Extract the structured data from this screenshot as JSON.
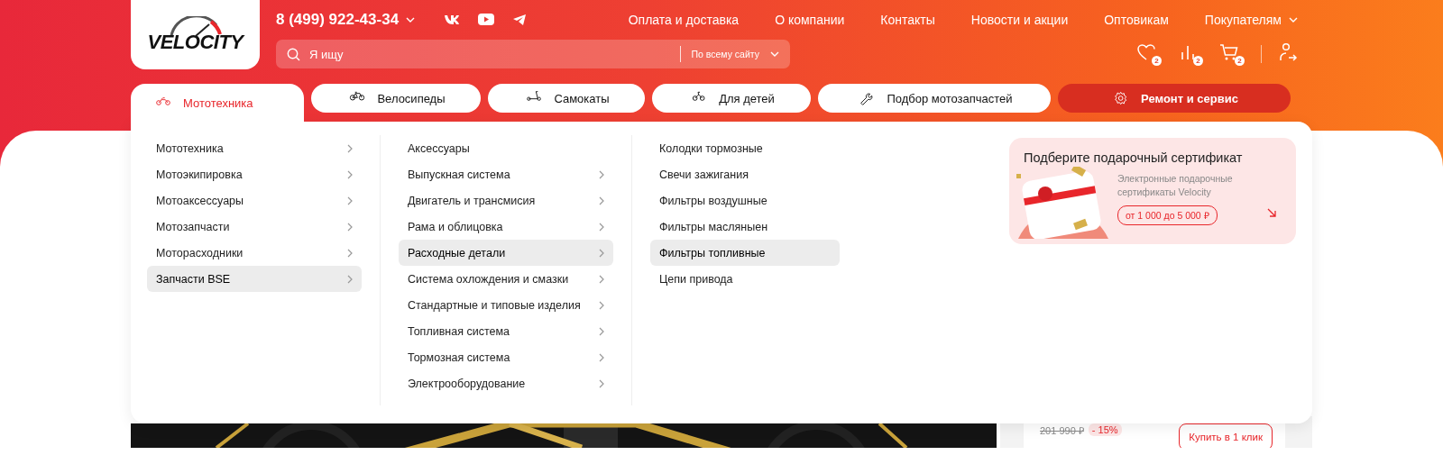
{
  "header": {
    "logo": "VELOCITY",
    "phone": "8 (499) 922-43-34",
    "nav_links": [
      {
        "label": "Оплата и доставка",
        "dropdown": false
      },
      {
        "label": "О компании",
        "dropdown": false
      },
      {
        "label": "Контакты",
        "dropdown": false
      },
      {
        "label": "Новости и акции",
        "dropdown": false
      },
      {
        "label": "Оптовикам",
        "dropdown": false
      },
      {
        "label": "Покупателям",
        "dropdown": true
      }
    ],
    "search": {
      "placeholder": "Я ищу",
      "scope": "По всему сайту"
    },
    "user_actions": [
      {
        "kind": "favorites",
        "badge": "2"
      },
      {
        "kind": "compare",
        "badge": "2"
      },
      {
        "kind": "cart",
        "badge": "2"
      },
      {
        "kind": "account"
      }
    ]
  },
  "categories": [
    {
      "label": "Мототехника",
      "kind": "moto",
      "selected": true,
      "accent": false
    },
    {
      "label": "Велосипеды",
      "kind": "bicycle",
      "selected": false,
      "accent": false
    },
    {
      "label": "Самокаты",
      "kind": "scooter",
      "selected": false,
      "accent": false
    },
    {
      "label": "Для детей",
      "kind": "kids",
      "selected": false,
      "accent": false
    },
    {
      "label": "Подбор мотозапчастей",
      "kind": "wrench",
      "selected": false,
      "accent": false
    },
    {
      "label": "Ремонт и сервис",
      "kind": "gear",
      "selected": false,
      "accent": true
    }
  ],
  "menu_columns": [
    {
      "items": [
        {
          "label": "Мототехника",
          "has_children": true,
          "selected": false
        },
        {
          "label": "Мотоэкипировка",
          "has_children": true,
          "selected": false
        },
        {
          "label": "Мотоаксессуары",
          "has_children": true,
          "selected": false
        },
        {
          "label": "Мотозапчасти",
          "has_children": true,
          "selected": false
        },
        {
          "label": "Моторасходники",
          "has_children": true,
          "selected": false
        },
        {
          "label": "Запчасти BSE",
          "has_children": true,
          "selected": true
        }
      ]
    },
    {
      "items": [
        {
          "label": "Аксессуары",
          "has_children": false,
          "selected": false
        },
        {
          "label": "Выпускная система",
          "has_children": true,
          "selected": false
        },
        {
          "label": "Двигатель и трансмисия",
          "has_children": true,
          "selected": false
        },
        {
          "label": "Рама и облицовка",
          "has_children": true,
          "selected": false
        },
        {
          "label": "Расходные детали",
          "has_children": true,
          "selected": true
        },
        {
          "label": "Система охлождения и смазки",
          "has_children": true,
          "selected": false
        },
        {
          "label": "Стандартные и типовые изделия",
          "has_children": true,
          "selected": false
        },
        {
          "label": "Топливная система",
          "has_children": true,
          "selected": false
        },
        {
          "label": "Тормозная система",
          "has_children": true,
          "selected": false
        },
        {
          "label": "Электрооборудование",
          "has_children": true,
          "selected": false
        }
      ]
    },
    {
      "items": [
        {
          "label": "Колодки тормозные",
          "has_children": false,
          "selected": false
        },
        {
          "label": "Свечи зажигания",
          "has_children": false,
          "selected": false
        },
        {
          "label": "Фильтры воздушные",
          "has_children": false,
          "selected": false
        },
        {
          "label": "Фильтры масляныен",
          "has_children": false,
          "selected": false
        },
        {
          "label": "Фильтры топливные",
          "has_children": false,
          "selected": true
        },
        {
          "label": "Цепи привода",
          "has_children": false,
          "selected": false
        }
      ]
    }
  ],
  "promo": {
    "title": "Подберите подарочный сертификат",
    "text": "Электронные подарочные сертификаты Velocity",
    "price_range": "от 1 000 до 5 000 ₽"
  },
  "product": {
    "old_price": "201 990 ₽",
    "discount": "- 15%",
    "buy_button": "Купить в 1 клик"
  }
}
